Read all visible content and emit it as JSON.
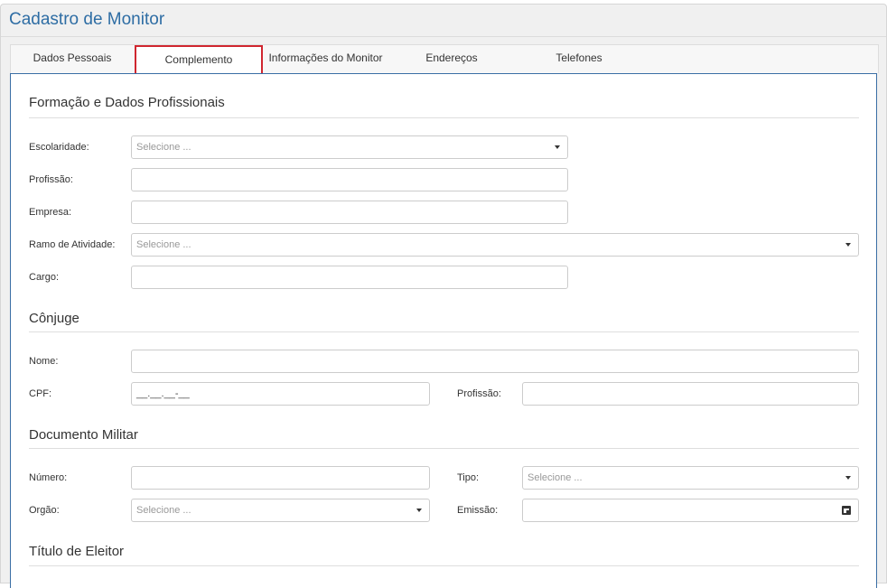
{
  "window": {
    "title": "Cadastro de Monitor"
  },
  "tabs": [
    {
      "label": "Dados Pessoais"
    },
    {
      "label": "Complemento"
    },
    {
      "label": "Informações do Monitor"
    },
    {
      "label": "Endereços"
    },
    {
      "label": "Telefones"
    }
  ],
  "active_tab": "Complemento",
  "sections": {
    "formacao": {
      "title": "Formação e Dados Profissionais",
      "escolaridade_label": "Escolaridade:",
      "escolaridade_placeholder": "Selecione ...",
      "profissao_label": "Profissão:",
      "empresa_label": "Empresa:",
      "ramo_label": "Ramo de Atividade:",
      "ramo_placeholder": "Selecione ...",
      "cargo_label": "Cargo:"
    },
    "conjuge": {
      "title": "Cônjuge",
      "nome_label": "Nome:",
      "cpf_label": "CPF:",
      "cpf_mask": "__.__.__-__",
      "profissao_label": "Profissão:"
    },
    "militar": {
      "title": "Documento Militar",
      "numero_label": "Número:",
      "tipo_label": "Tipo:",
      "tipo_placeholder": "Selecione ...",
      "orgao_label": "Orgão:",
      "orgao_placeholder": "Selecione ...",
      "emissao_label": "Emissão:"
    },
    "eleitor": {
      "title": "Título de Eleitor"
    }
  },
  "colors": {
    "title_blue": "#2e6da4",
    "active_tab_border": "#d0262f",
    "panel_border": "#3a6ea5"
  }
}
